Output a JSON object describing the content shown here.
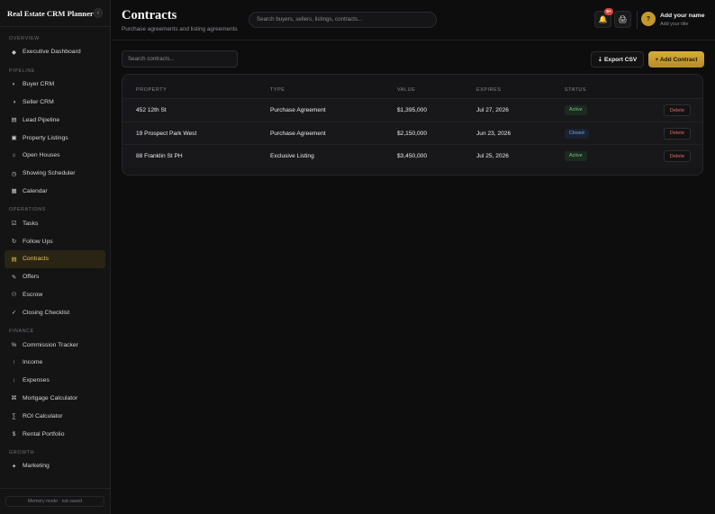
{
  "app": {
    "title": "Real Estate CRM Planner",
    "collapse_icon": "chevron-left-icon",
    "collapse_glyph": "‹",
    "memory_status": "Memory mode · not saved"
  },
  "sidebar": {
    "sections": [
      {
        "label": "OVERVIEW",
        "items": [
          {
            "label": "Executive Dashboard",
            "icon": "diamond-icon",
            "glyph": "◆"
          }
        ]
      },
      {
        "label": "PIPELINE",
        "items": [
          {
            "label": "Buyer CRM",
            "icon": "half-circle-icon",
            "glyph": "◐"
          },
          {
            "label": "Seller CRM",
            "icon": "half-circle-icon",
            "glyph": "◑"
          },
          {
            "label": "Lead Pipeline",
            "icon": "pipeline-icon",
            "glyph": "▤"
          },
          {
            "label": "Property Listings",
            "icon": "listing-icon",
            "glyph": "▣"
          },
          {
            "label": "Open Houses",
            "icon": "home-icon",
            "glyph": "⌂"
          },
          {
            "label": "Showing Scheduler",
            "icon": "clock-icon",
            "glyph": "◷"
          },
          {
            "label": "Calendar",
            "icon": "calendar-icon",
            "glyph": "▦"
          }
        ]
      },
      {
        "label": "OPERATIONS",
        "items": [
          {
            "label": "Tasks",
            "icon": "checkbox-icon",
            "glyph": "☑"
          },
          {
            "label": "Follow Ups",
            "icon": "refresh-icon",
            "glyph": "↻"
          },
          {
            "label": "Contracts",
            "icon": "contract-icon",
            "glyph": "▤",
            "active": true
          },
          {
            "label": "Offers",
            "icon": "pencil-icon",
            "glyph": "✎"
          },
          {
            "label": "Escrow",
            "icon": "escrow-icon",
            "glyph": "⚇"
          },
          {
            "label": "Closing Checklist",
            "icon": "check-icon",
            "glyph": "✓"
          }
        ]
      },
      {
        "label": "FINANCE",
        "items": [
          {
            "label": "Commission Tracker",
            "icon": "percent-icon",
            "glyph": "%"
          },
          {
            "label": "Income",
            "icon": "arrow-up-icon",
            "glyph": "↑"
          },
          {
            "label": "Expenses",
            "icon": "arrow-down-icon",
            "glyph": "↓"
          },
          {
            "label": "Mortgage Calculator",
            "icon": "calculator-icon",
            "glyph": "⌘"
          },
          {
            "label": "ROI Calculator",
            "icon": "sigma-icon",
            "glyph": "∑"
          },
          {
            "label": "Rental Portfolio",
            "icon": "dollar-icon",
            "glyph": "$"
          }
        ]
      },
      {
        "label": "GROWTH",
        "items": [
          {
            "label": "Marketing",
            "icon": "sparkle-icon",
            "glyph": "✦"
          }
        ]
      }
    ]
  },
  "header": {
    "title": "Contracts",
    "subtitle": "Purchase agreements and listing agreements",
    "search_placeholder": "Search buyers, sellers, listings, contracts...",
    "notifications_badge": "9+",
    "bell_glyph": "🔔",
    "printer_glyph": "🖨",
    "avatar_initial": "?",
    "user_name": "Add your name",
    "user_title": "Add your title"
  },
  "toolbar": {
    "search_placeholder": "Search contracts...",
    "export_label": "⇣ Export CSV",
    "add_label": "+ Add Contract"
  },
  "table": {
    "columns": [
      "PROPERTY",
      "TYPE",
      "VALUE",
      "EXPIRES",
      "STATUS"
    ],
    "delete_label": "Delete",
    "rows": [
      {
        "property": "452 12th St",
        "type": "Purchase Agreement",
        "value": "$1,395,000",
        "expires": "Jul 27, 2026",
        "status": "Active"
      },
      {
        "property": "19 Prospect Park West",
        "type": "Purchase Agreement",
        "value": "$2,150,000",
        "expires": "Jun 23, 2026",
        "status": "Closed"
      },
      {
        "property": "88 Franklin St PH",
        "type": "Exclusive Listing",
        "value": "$3,450,000",
        "expires": "Jul 25, 2026",
        "status": "Active"
      }
    ]
  },
  "colors": {
    "accent": "#d4a937",
    "active_status": "#6fc483",
    "closed_status": "#7ea4e0",
    "danger": "#e06a6a"
  }
}
